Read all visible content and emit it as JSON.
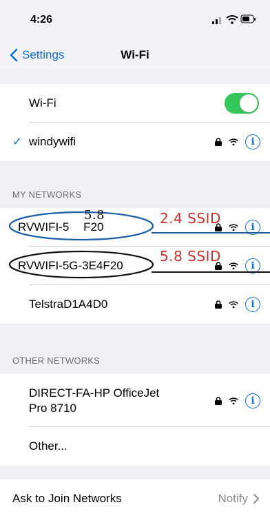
{
  "status": {
    "time": "4:26"
  },
  "nav": {
    "back_label": "Settings",
    "title": "Wi-Fi"
  },
  "wifi_toggle": {
    "label": "Wi-Fi",
    "on": true
  },
  "connected": {
    "name": "windywifi"
  },
  "my_networks": {
    "header": "MY NETWORKS",
    "items": [
      {
        "name": "RVWIFI-5E4F20"
      },
      {
        "name": "RVWIFI-5G-3E4F20"
      },
      {
        "name": "TelstraD1A4D0"
      }
    ]
  },
  "annotations": {
    "handwritten_small": "5.8",
    "label_24": "2.4 SSID",
    "label_58": "5.8 SSID"
  },
  "other_networks": {
    "header": "OTHER NETWORKS",
    "items": [
      {
        "name_line1": "DIRECT-FA-HP OfficeJet",
        "name_line2": "Pro 8710"
      },
      {
        "name": "Other..."
      }
    ]
  },
  "ask_to_join": {
    "label": "Ask to Join Networks",
    "value": "Notify"
  },
  "colors": {
    "accent": "#0a6ed8",
    "toggle": "#34c759",
    "annotation_red": "#d62b2b",
    "annotation_blue": "#1a5fa8"
  }
}
